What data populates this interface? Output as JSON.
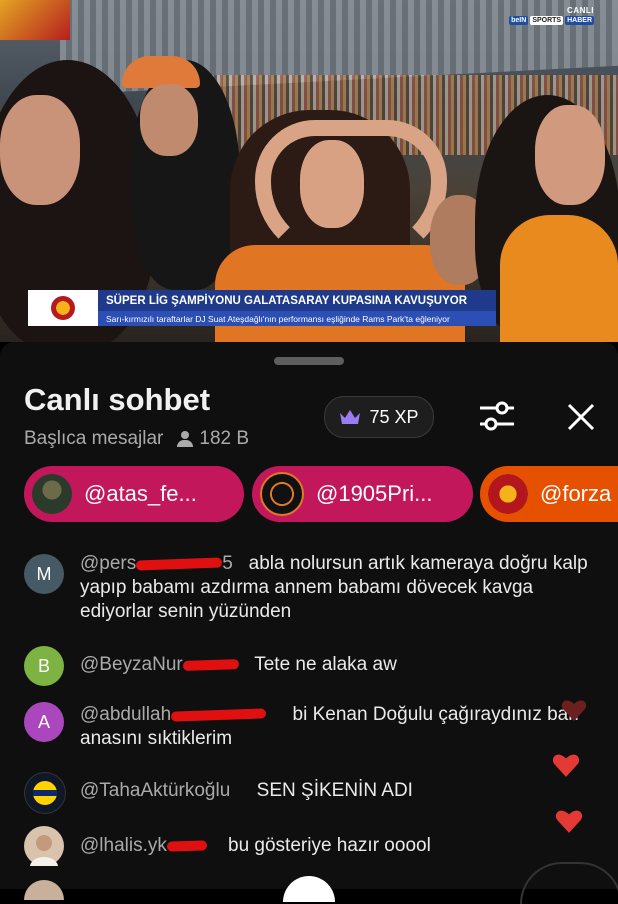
{
  "video": {
    "broadcast_live": "CANLI",
    "broadcast_logos": [
      "beIN",
      "SPORTS",
      "HABER"
    ],
    "caption_title": "SÜPER LİG ŞAMPİYONU GALATASARAY KUPASINA KAVUŞUYOR",
    "caption_subtitle": "Sarı-kırmızılı taraftarlar DJ Suat Ateşdağlı'nın performansı eşliğinde Rams Park'ta eğleniyor"
  },
  "chat": {
    "title": "Canlı sohbet",
    "mode": "Başlıca mesajlar",
    "viewer_count": "182 B",
    "xp": "75 XP",
    "pinned": [
      {
        "handle": "@atas_fe..."
      },
      {
        "handle": "@1905Pri..."
      },
      {
        "handle": "@forza"
      }
    ],
    "messages": [
      {
        "avatar_letter": "M",
        "avatar_color": "#455a64",
        "user": "@pers",
        "user_tail": "5",
        "text": "abla nolursun artık kameraya doğru kalp yapıp babamı azdırma annem babamı dövecek kavga ediyorlar senin yüzünden"
      },
      {
        "avatar_letter": "B",
        "avatar_color": "#7cb342",
        "user": "@BeyzaNur",
        "user_tail": "",
        "text": "Tete ne alaka aw"
      },
      {
        "avatar_letter": "A",
        "avatar_color": "#ab47bc",
        "user": "@abdullah",
        "user_tail": "",
        "text": "bi Kenan Doğulu çağıraydınız bari anasını sıktiklerim"
      },
      {
        "avatar_letter": "",
        "avatar_color": "#101828",
        "user": "@TahaAktürkoğlu",
        "user_tail": "",
        "text": "SEN ŞİKENİN ADI"
      },
      {
        "avatar_letter": "",
        "avatar_color": "#d9c3ad",
        "user": "@lhalis.yk",
        "user_tail": "",
        "text": "bu gösteriye hazır ooool"
      }
    ]
  },
  "colors": {
    "chip_pink": "#c2185b",
    "chip_orange": "#e65100",
    "heart": "#e53935",
    "panel_bg": "#0f0f0f"
  },
  "icons": [
    "crown-icon",
    "filter-icon",
    "close-icon",
    "person-icon",
    "heart-icon"
  ]
}
